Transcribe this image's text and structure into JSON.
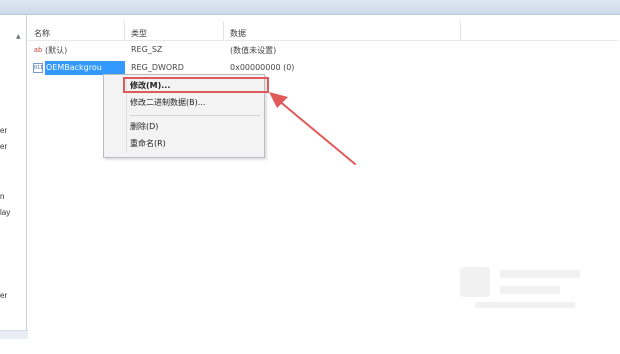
{
  "columns": {
    "name": "名称",
    "type": "类型",
    "data": "数据"
  },
  "rows": [
    {
      "icon": "string-value-icon",
      "name": "(默认)",
      "type": "REG_SZ",
      "data": "(数值未设置)"
    },
    {
      "icon": "dword-value-icon",
      "name": "OEMBackgrou",
      "type": "REG_DWORD",
      "data": "0x00000000 (0)"
    }
  ],
  "context_menu": {
    "items": [
      {
        "label": "修改(M)...",
        "bold": true
      },
      {
        "label": "修改二进制数据(B)..."
      },
      {
        "label": "删除(D)"
      },
      {
        "label": "重命名(R)"
      }
    ]
  },
  "tree_fragments": [
    "er",
    "er",
    "n",
    "lay",
    "er"
  ],
  "colors": {
    "selection": "#3399ff",
    "annotation": "#e15a5a"
  }
}
